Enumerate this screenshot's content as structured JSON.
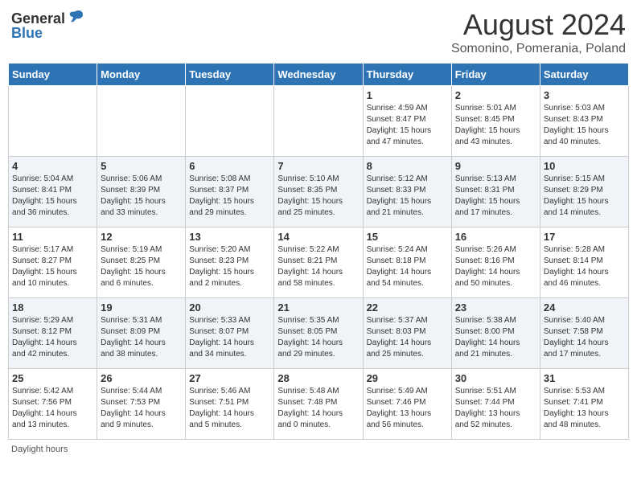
{
  "header": {
    "logo_general": "General",
    "logo_blue": "Blue",
    "month_title": "August 2024",
    "location": "Somonino, Pomerania, Poland"
  },
  "days_of_week": [
    "Sunday",
    "Monday",
    "Tuesday",
    "Wednesday",
    "Thursday",
    "Friday",
    "Saturday"
  ],
  "footer_note": "Daylight hours",
  "weeks": [
    [
      {
        "day": "",
        "info": ""
      },
      {
        "day": "",
        "info": ""
      },
      {
        "day": "",
        "info": ""
      },
      {
        "day": "",
        "info": ""
      },
      {
        "day": "1",
        "info": "Sunrise: 4:59 AM\nSunset: 8:47 PM\nDaylight: 15 hours\nand 47 minutes."
      },
      {
        "day": "2",
        "info": "Sunrise: 5:01 AM\nSunset: 8:45 PM\nDaylight: 15 hours\nand 43 minutes."
      },
      {
        "day": "3",
        "info": "Sunrise: 5:03 AM\nSunset: 8:43 PM\nDaylight: 15 hours\nand 40 minutes."
      }
    ],
    [
      {
        "day": "4",
        "info": "Sunrise: 5:04 AM\nSunset: 8:41 PM\nDaylight: 15 hours\nand 36 minutes."
      },
      {
        "day": "5",
        "info": "Sunrise: 5:06 AM\nSunset: 8:39 PM\nDaylight: 15 hours\nand 33 minutes."
      },
      {
        "day": "6",
        "info": "Sunrise: 5:08 AM\nSunset: 8:37 PM\nDaylight: 15 hours\nand 29 minutes."
      },
      {
        "day": "7",
        "info": "Sunrise: 5:10 AM\nSunset: 8:35 PM\nDaylight: 15 hours\nand 25 minutes."
      },
      {
        "day": "8",
        "info": "Sunrise: 5:12 AM\nSunset: 8:33 PM\nDaylight: 15 hours\nand 21 minutes."
      },
      {
        "day": "9",
        "info": "Sunrise: 5:13 AM\nSunset: 8:31 PM\nDaylight: 15 hours\nand 17 minutes."
      },
      {
        "day": "10",
        "info": "Sunrise: 5:15 AM\nSunset: 8:29 PM\nDaylight: 15 hours\nand 14 minutes."
      }
    ],
    [
      {
        "day": "11",
        "info": "Sunrise: 5:17 AM\nSunset: 8:27 PM\nDaylight: 15 hours\nand 10 minutes."
      },
      {
        "day": "12",
        "info": "Sunrise: 5:19 AM\nSunset: 8:25 PM\nDaylight: 15 hours\nand 6 minutes."
      },
      {
        "day": "13",
        "info": "Sunrise: 5:20 AM\nSunset: 8:23 PM\nDaylight: 15 hours\nand 2 minutes."
      },
      {
        "day": "14",
        "info": "Sunrise: 5:22 AM\nSunset: 8:21 PM\nDaylight: 14 hours\nand 58 minutes."
      },
      {
        "day": "15",
        "info": "Sunrise: 5:24 AM\nSunset: 8:18 PM\nDaylight: 14 hours\nand 54 minutes."
      },
      {
        "day": "16",
        "info": "Sunrise: 5:26 AM\nSunset: 8:16 PM\nDaylight: 14 hours\nand 50 minutes."
      },
      {
        "day": "17",
        "info": "Sunrise: 5:28 AM\nSunset: 8:14 PM\nDaylight: 14 hours\nand 46 minutes."
      }
    ],
    [
      {
        "day": "18",
        "info": "Sunrise: 5:29 AM\nSunset: 8:12 PM\nDaylight: 14 hours\nand 42 minutes."
      },
      {
        "day": "19",
        "info": "Sunrise: 5:31 AM\nSunset: 8:09 PM\nDaylight: 14 hours\nand 38 minutes."
      },
      {
        "day": "20",
        "info": "Sunrise: 5:33 AM\nSunset: 8:07 PM\nDaylight: 14 hours\nand 34 minutes."
      },
      {
        "day": "21",
        "info": "Sunrise: 5:35 AM\nSunset: 8:05 PM\nDaylight: 14 hours\nand 29 minutes."
      },
      {
        "day": "22",
        "info": "Sunrise: 5:37 AM\nSunset: 8:03 PM\nDaylight: 14 hours\nand 25 minutes."
      },
      {
        "day": "23",
        "info": "Sunrise: 5:38 AM\nSunset: 8:00 PM\nDaylight: 14 hours\nand 21 minutes."
      },
      {
        "day": "24",
        "info": "Sunrise: 5:40 AM\nSunset: 7:58 PM\nDaylight: 14 hours\nand 17 minutes."
      }
    ],
    [
      {
        "day": "25",
        "info": "Sunrise: 5:42 AM\nSunset: 7:56 PM\nDaylight: 14 hours\nand 13 minutes."
      },
      {
        "day": "26",
        "info": "Sunrise: 5:44 AM\nSunset: 7:53 PM\nDaylight: 14 hours\nand 9 minutes."
      },
      {
        "day": "27",
        "info": "Sunrise: 5:46 AM\nSunset: 7:51 PM\nDaylight: 14 hours\nand 5 minutes."
      },
      {
        "day": "28",
        "info": "Sunrise: 5:48 AM\nSunset: 7:48 PM\nDaylight: 14 hours\nand 0 minutes."
      },
      {
        "day": "29",
        "info": "Sunrise: 5:49 AM\nSunset: 7:46 PM\nDaylight: 13 hours\nand 56 minutes."
      },
      {
        "day": "30",
        "info": "Sunrise: 5:51 AM\nSunset: 7:44 PM\nDaylight: 13 hours\nand 52 minutes."
      },
      {
        "day": "31",
        "info": "Sunrise: 5:53 AM\nSunset: 7:41 PM\nDaylight: 13 hours\nand 48 minutes."
      }
    ]
  ]
}
